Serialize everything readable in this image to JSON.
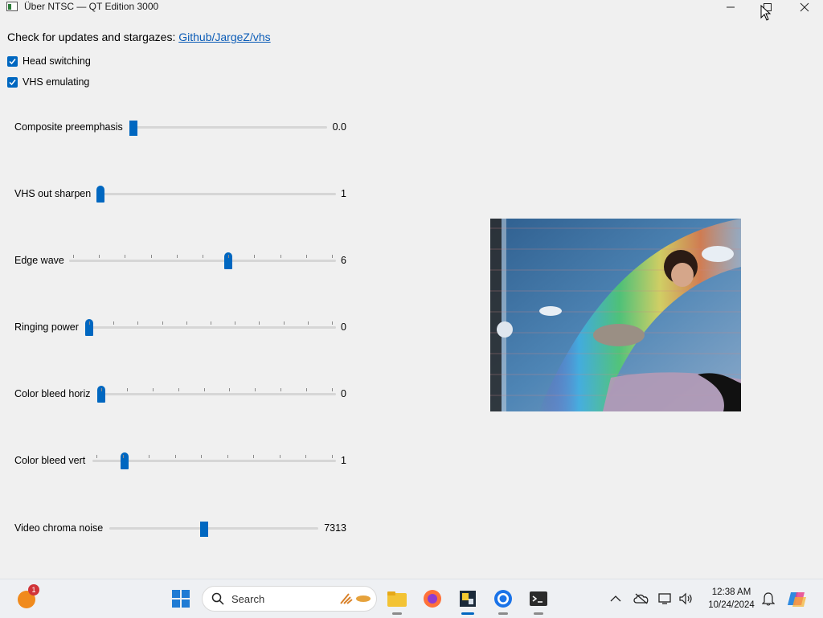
{
  "window": {
    "title": "Über NTSC — QT Edition 3000"
  },
  "header": {
    "prompt": "Check for updates and stargazes:",
    "link": "Github/JargeZ/vhs"
  },
  "checks": [
    {
      "label": "Head switching",
      "checked": true
    },
    {
      "label": "VHS emulating",
      "checked": true
    }
  ],
  "sliders": [
    {
      "label": "Composite preemphasis",
      "value": "0.0",
      "fraction": 0.0
    },
    {
      "label": "VHS out sharpen",
      "value": "1",
      "fraction": 0.0
    },
    {
      "label": "Edge wave",
      "value": "6",
      "fraction": 0.6
    },
    {
      "label": "Ringing power",
      "value": "0",
      "fraction": 0.0
    },
    {
      "label": "Color bleed horiz",
      "value": "0",
      "fraction": 0.0
    },
    {
      "label": "Color bleed vert",
      "value": "1",
      "fraction": 0.12
    },
    {
      "label": "Video chroma noise",
      "value": "7313",
      "fraction": 0.45
    }
  ],
  "taskbar": {
    "search_placeholder": "Search",
    "notification_count": "1",
    "time": "12:38 AM",
    "date": "10/24/2024"
  }
}
